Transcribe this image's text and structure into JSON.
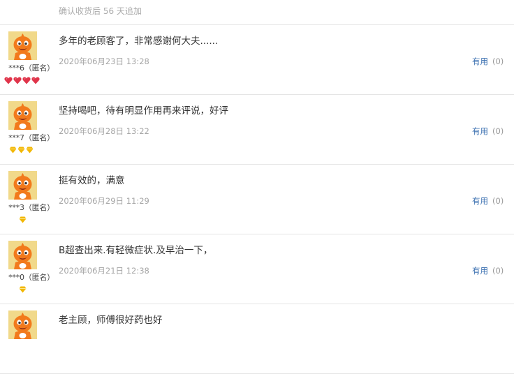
{
  "header": {
    "note": "确认收货后 56 天追加"
  },
  "reviews": [
    {
      "user": "***6（匿名）",
      "badge": "red-heart",
      "badge_count": 4,
      "comment": "多年的老顾客了，非常感谢何大夫......",
      "time": "2020年06月23日 13:28",
      "helpful_label": "有用",
      "helpful_count": "(0)"
    },
    {
      "user": "***7（匿名）",
      "badge": "yellow-diamond",
      "badge_count": 3,
      "comment": "坚持喝吧，待有明显作用再来评说，好评",
      "time": "2020年06月28日 13:22",
      "helpful_label": "有用",
      "helpful_count": "(0)"
    },
    {
      "user": "***3（匿名）",
      "badge": "yellow-diamond",
      "badge_count": 1,
      "comment": "挺有效的，满意",
      "time": "2020年06月29日 11:29",
      "helpful_label": "有用",
      "helpful_count": "(0)"
    },
    {
      "user": "***0（匿名）",
      "badge": "yellow-diamond",
      "badge_count": 1,
      "comment": "B超查出来.有轻微症状.及早治一下，",
      "time": "2020年06月21日 12:38",
      "helpful_label": "有用",
      "helpful_count": "(0)"
    },
    {
      "comment": "老主顾，师傅很好药也好"
    }
  ],
  "colors": {
    "helpful_link": "#3a6fb0",
    "avatar_bg": "#f1d98a",
    "avatar_figure": "#f27a1c",
    "heart": "#e0344a",
    "diamond": "#f2b705"
  }
}
